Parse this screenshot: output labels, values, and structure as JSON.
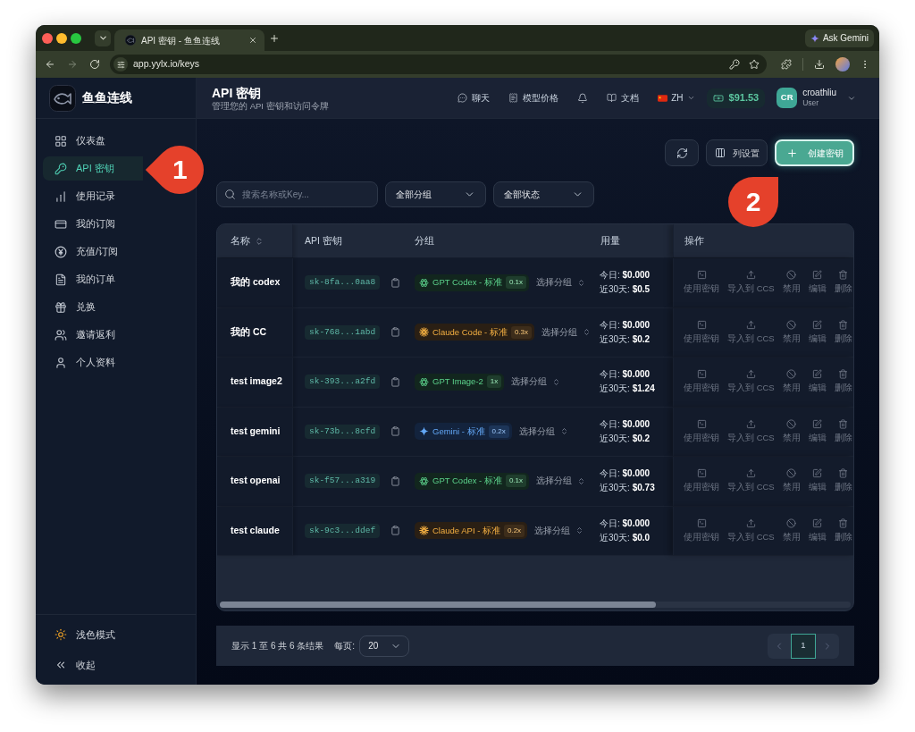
{
  "browser": {
    "tab_title": "API 密钥 - 鱼鱼连线",
    "ask_button": "Ask Gemini",
    "url": "app.yylx.io/keys"
  },
  "sidebar": {
    "brand": "鱼鱼连线",
    "items": [
      {
        "kind": "dashboard",
        "label": "仪表盘",
        "selected": false
      },
      {
        "kind": "keys",
        "label": "API 密钥",
        "selected": true
      },
      {
        "kind": "usage",
        "label": "使用记录",
        "selected": false
      },
      {
        "kind": "subscription",
        "label": "我的订阅",
        "selected": false
      },
      {
        "kind": "recharge",
        "label": "充值/订阅",
        "selected": false
      },
      {
        "kind": "orders",
        "label": "我的订单",
        "selected": false
      },
      {
        "kind": "redeem",
        "label": "兑换",
        "selected": false
      },
      {
        "kind": "referral",
        "label": "邀请返利",
        "selected": false
      },
      {
        "kind": "profile",
        "label": "个人资料",
        "selected": false
      }
    ],
    "footer": [
      {
        "kind": "theme",
        "label": "浅色模式"
      },
      {
        "kind": "collapse",
        "label": "收起"
      }
    ]
  },
  "header": {
    "title": "API 密钥",
    "subtitle": "管理您的 API 密钥和访问令牌",
    "nav": [
      {
        "kind": "chat",
        "label": "聊天"
      },
      {
        "kind": "pricing",
        "label": "模型价格"
      },
      {
        "kind": "notifications"
      },
      {
        "kind": "docs",
        "label": "文档"
      }
    ],
    "language": "ZH",
    "balance": "$91.53",
    "user": {
      "initials": "CR",
      "name": "croathliu",
      "role": "User"
    }
  },
  "toolbar": {
    "column_settings": "列设置",
    "create": "创建密钥"
  },
  "filters": {
    "search": {
      "placeholder": "搜索名称或Key..."
    },
    "group": "全部分组",
    "status": "全部状态"
  },
  "table": {
    "columns": [
      {
        "label": "名称",
        "sortable": true
      },
      {
        "label": "API 密钥",
        "sortable": false
      },
      {
        "label": "分组",
        "sortable": false
      },
      {
        "label": "用量",
        "sortable": false
      },
      {
        "label": "操作",
        "sortable": false
      }
    ],
    "rows": [
      {
        "name": "我的 codex",
        "key": "sk-8fa...0aa8",
        "group": {
          "kind": "openai",
          "label": "GPT Codex - 标准",
          "rate": "0.1x"
        },
        "select": "选择分组",
        "today": "今日: **$0.000**",
        "month": "近30天: **$0.5**",
        "actions": [
          {
            "kind": "use",
            "label": "使用密钥"
          },
          {
            "kind": "import",
            "label": "导入到 CCS"
          },
          {
            "kind": "disable",
            "label": "禁用"
          },
          {
            "kind": "edit",
            "label": "编辑"
          },
          {
            "kind": "delete",
            "label": "删除"
          }
        ]
      },
      {
        "name": "我的 CC",
        "key": "sk-768...1abd",
        "group": {
          "kind": "claude",
          "label": "Claude Code - 标准",
          "rate": "0.3x"
        },
        "select": "选择分组",
        "today": "今日: **$0.000**",
        "month": "近30天: **$0.2**",
        "actions": [
          {
            "kind": "use",
            "label": "使用密钥"
          },
          {
            "kind": "import",
            "label": "导入到 CCS"
          },
          {
            "kind": "disable",
            "label": "禁用"
          },
          {
            "kind": "edit",
            "label": "编辑"
          },
          {
            "kind": "delete",
            "label": "删除"
          }
        ]
      },
      {
        "name": "test image2",
        "key": "sk-393...a2fd",
        "group": {
          "kind": "openai",
          "label": "GPT Image-2",
          "rate": "1x"
        },
        "select": "选择分组",
        "today": "今日: **$0.000**",
        "month": "近30天: **$1.24**",
        "actions": [
          {
            "kind": "use",
            "label": "使用密钥"
          },
          {
            "kind": "import",
            "label": "导入到 CCS"
          },
          {
            "kind": "disable",
            "label": "禁用"
          },
          {
            "kind": "edit",
            "label": "编辑"
          },
          {
            "kind": "delete",
            "label": "删除"
          }
        ]
      },
      {
        "name": "test gemini",
        "key": "sk-73b...8cfd",
        "group": {
          "kind": "gemini",
          "label": "Gemini - 标准",
          "rate": "0.2x"
        },
        "select": "选择分组",
        "today": "今日: **$0.000**",
        "month": "近30天: **$0.2**",
        "actions": [
          {
            "kind": "use",
            "label": "使用密钥"
          },
          {
            "kind": "import",
            "label": "导入到 CCS"
          },
          {
            "kind": "disable",
            "label": "禁用"
          },
          {
            "kind": "edit",
            "label": "编辑"
          },
          {
            "kind": "delete",
            "label": "删除"
          }
        ]
      },
      {
        "name": "test openai",
        "key": "sk-f57...a319",
        "group": {
          "kind": "openai",
          "label": "GPT Codex - 标准",
          "rate": "0.1x"
        },
        "select": "选择分组",
        "today": "今日: **$0.000**",
        "month": "近30天: **$0.73**",
        "actions": [
          {
            "kind": "use",
            "label": "使用密钥"
          },
          {
            "kind": "import",
            "label": "导入到 CCS"
          },
          {
            "kind": "disable",
            "label": "禁用"
          },
          {
            "kind": "edit",
            "label": "编辑"
          },
          {
            "kind": "delete",
            "label": "删除"
          }
        ]
      },
      {
        "name": "test claude",
        "key": "sk-9c3...ddef",
        "group": {
          "kind": "claude",
          "label": "Claude API - 标准",
          "rate": "0.2x"
        },
        "select": "选择分组",
        "today": "今日: **$0.000**",
        "month": "近30天: **$0.0**",
        "actions": [
          {
            "kind": "use",
            "label": "使用密钥"
          },
          {
            "kind": "import",
            "label": "导入到 CCS"
          },
          {
            "kind": "disable",
            "label": "禁用"
          },
          {
            "kind": "edit",
            "label": "编辑"
          },
          {
            "kind": "delete",
            "label": "删除"
          }
        ]
      }
    ]
  },
  "pagination": {
    "summary": "显示 1 至 6 共 6 条结果",
    "per_page_label": "每页:",
    "per_page": "20",
    "prev": {
      "disabled": true
    },
    "pages": [
      {
        "label": "1",
        "selected": true
      }
    ],
    "next": {
      "disabled": true
    }
  },
  "annotations": [
    {
      "label": "1"
    },
    {
      "label": "2"
    }
  ]
}
